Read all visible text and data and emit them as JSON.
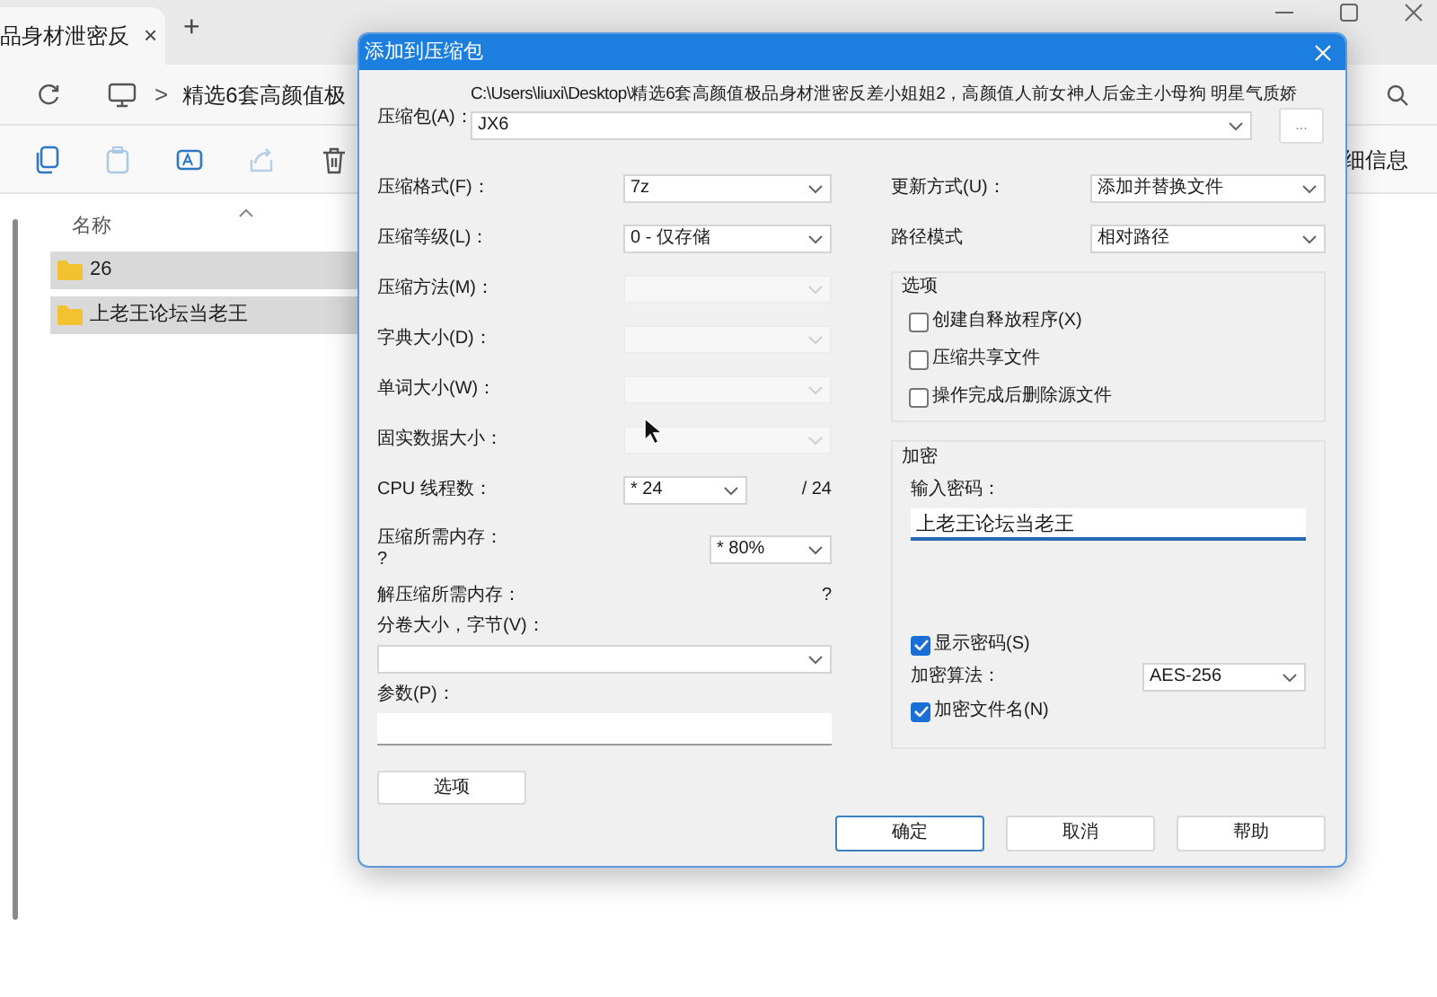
{
  "browser_tab": {
    "title": "品身材泄密反",
    "close": "×",
    "new": "+"
  },
  "address_bar": {
    "separator": ">",
    "path": "精选6套高颜值极"
  },
  "toolbar": {
    "details": "细信息"
  },
  "file_list": {
    "column": "名称",
    "items": [
      {
        "name": "26",
        "selected": true
      },
      {
        "name": "上老王论坛当老王",
        "selected": true
      }
    ]
  },
  "dialog": {
    "title": "添加到压缩包",
    "archive": {
      "label": "压缩包(A)：",
      "path": "C:\\Users\\liuxi\\Desktop\\精选6套高颜值极品身材泄密反差小姐姐2，高颜值人前女神人后金主小母狗 明星气质娇",
      "value": "JX6",
      "browse": "..."
    },
    "left_fields": [
      {
        "kind": "select",
        "label": "压缩格式(F)：",
        "value": "7z",
        "disabled": false
      },
      {
        "kind": "select",
        "label": "压缩等级(L)：",
        "value": "0 - 仅存储",
        "disabled": false
      },
      {
        "kind": "select",
        "label": "压缩方法(M)：",
        "disabled": true
      },
      {
        "kind": "select",
        "label": "字典大小(D)：",
        "disabled": true
      },
      {
        "kind": "select",
        "label": "单词大小(W)：",
        "disabled": true
      },
      {
        "kind": "select",
        "label": "固实数据大小：",
        "disabled": true
      },
      {
        "kind": "threads",
        "label": "CPU 线程数：",
        "value": "* 24",
        "suffix": "/ 24"
      },
      {
        "kind": "memory",
        "label": "压缩所需内存：",
        "note": "?",
        "value": "* 80%"
      },
      {
        "kind": "info",
        "label": "解压缩所需内存：",
        "value": "?"
      },
      {
        "kind": "wide_select",
        "label": "分卷大小，字节(V)："
      },
      {
        "kind": "text_input",
        "label": "参数(P)："
      }
    ],
    "options_button": "选项",
    "right_fields": [
      {
        "label": "更新方式(U)：",
        "value": "添加并替换文件"
      },
      {
        "label": "路径模式",
        "value": "相对路径"
      }
    ],
    "options_group": {
      "title": "选项",
      "items": [
        {
          "label": "创建自释放程序(X)",
          "checked": false
        },
        {
          "label": "压缩共享文件",
          "checked": false
        },
        {
          "label": "操作完成后删除源文件",
          "checked": false
        }
      ]
    },
    "encryption": {
      "title": "加密",
      "password_label": "输入密码：",
      "password": "上老王论坛当老王",
      "show_password": {
        "label": "显示密码(S)",
        "checked": true
      },
      "method_label": "加密算法：",
      "method": "AES-256",
      "encrypt_names": {
        "label": "加密文件名(N)",
        "checked": true
      }
    },
    "buttons": [
      {
        "label": "确定",
        "default": true
      },
      {
        "label": "取消",
        "default": false
      },
      {
        "label": "帮助",
        "default": false
      }
    ]
  }
}
